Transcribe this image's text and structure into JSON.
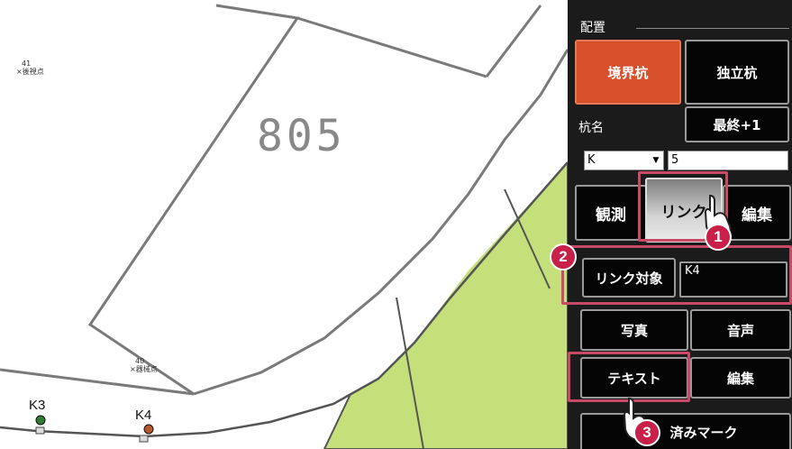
{
  "map": {
    "parcel_number": "805",
    "labels": [
      {
        "id": "41",
        "name": "後視点"
      },
      {
        "id": "40",
        "name": "器械点"
      }
    ],
    "points": [
      {
        "name": "K3",
        "color": "#2e7d32"
      },
      {
        "name": "K4",
        "color": "#b5562c"
      }
    ],
    "green_color": "#c5e07a"
  },
  "panel": {
    "section_title": "配置",
    "boundary_stake_label": "境界杭",
    "independent_stake_label": "独立杭",
    "stake_name_label": "杭名",
    "last_plus_one_label": "最終+1",
    "prefix_value": "K",
    "number_value": "5",
    "tabs": {
      "observe": "観測",
      "link": "リンク",
      "edit": "編集"
    },
    "link_target_label": "リンク対象",
    "link_target_value": "K4",
    "photo_label": "写真",
    "audio_label": "音声",
    "text_label": "テキスト",
    "edit2_label": "編集",
    "done_mark_label": "済みマーク"
  },
  "callouts": [
    "1",
    "2",
    "3"
  ],
  "colors": {
    "accent_orange": "#d8512c",
    "highlight": "#c94a66",
    "badge": "#c82048"
  }
}
